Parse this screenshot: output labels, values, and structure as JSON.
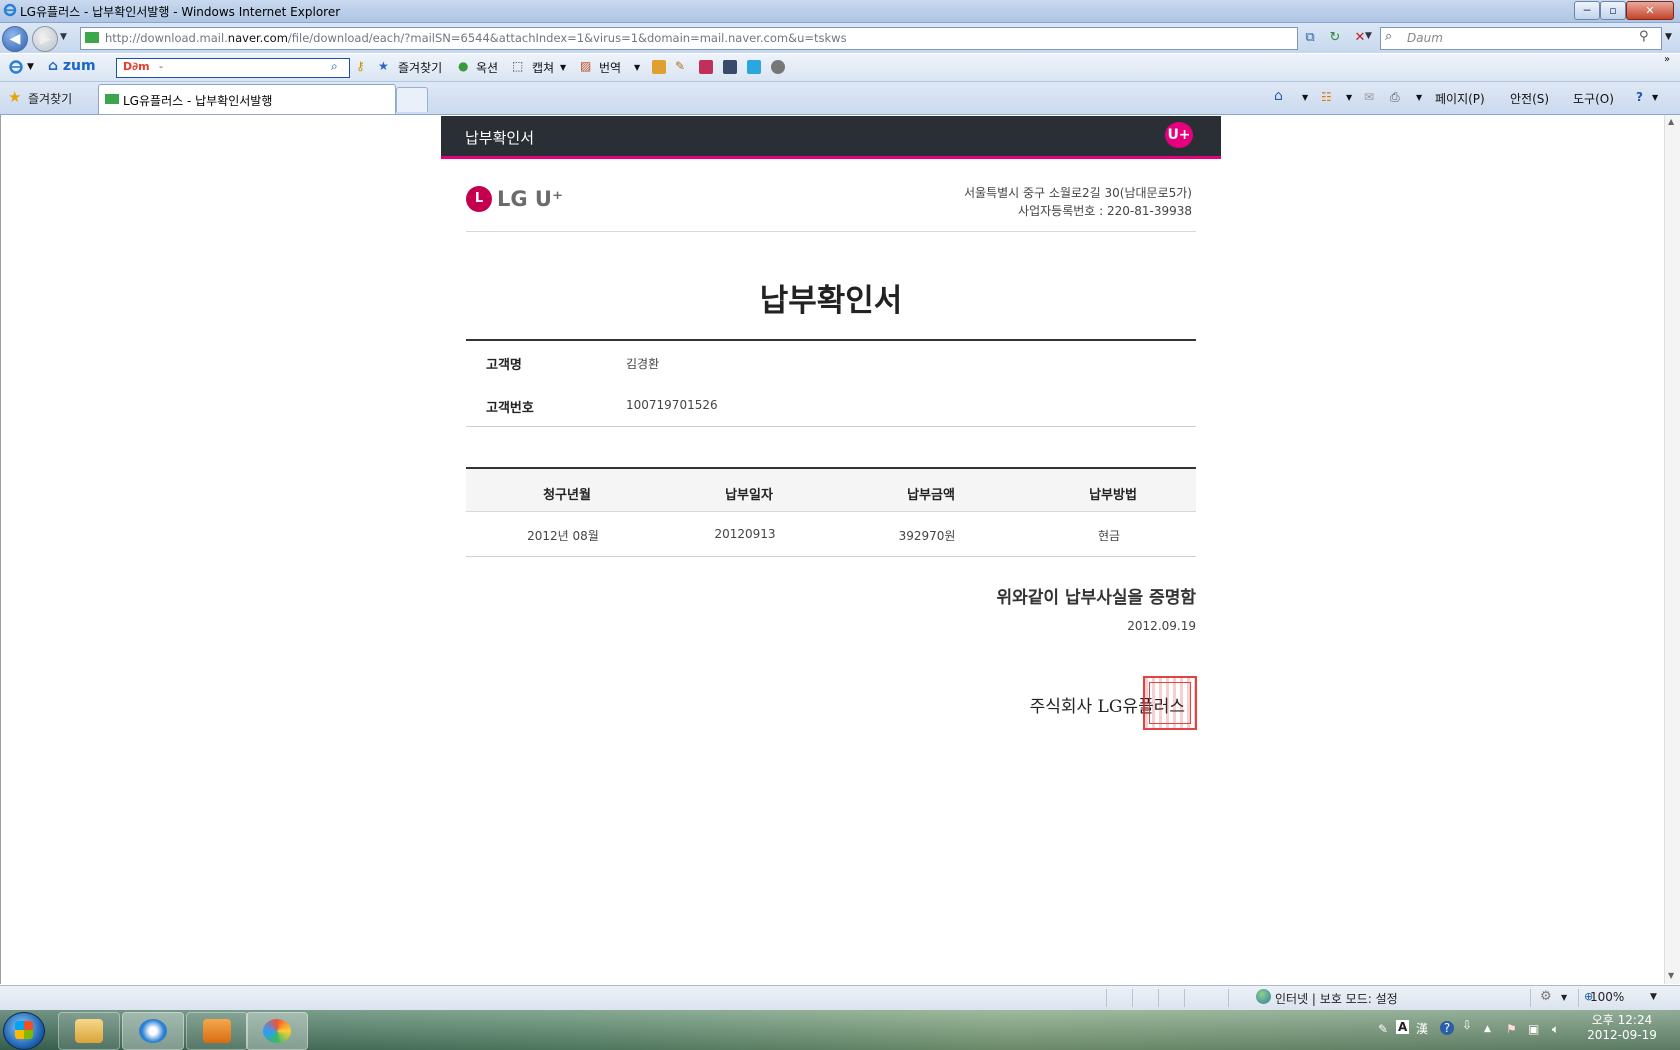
{
  "window": {
    "title": "LG유플러스 - 납부확인서발행 - Windows Internet Explorer",
    "minimize": "─",
    "maximize": "▫",
    "close": "✕"
  },
  "address_bar": {
    "url_prefix": "http://download.mail.",
    "url_domain": "naver.com",
    "url_rest": "/file/download/each/?mailSN=6544&attachIndex=1&virus=1&domain=mail.naver.com&u=tskws",
    "search_engine": "Daum"
  },
  "toolbar": {
    "zum": "zum",
    "daum": "D∂m",
    "daum_value": "-",
    "favorites": "즐겨찾기",
    "options": "옥션",
    "capture": "캡쳐",
    "translate": "번역"
  },
  "tabs": {
    "favorites": "즐겨찾기",
    "active": "LG유플러스 - 납부확인서발행"
  },
  "commands": {
    "page": "페이지(P)",
    "safety": "안전(S)",
    "tools": "도구(O)"
  },
  "document": {
    "header_title": "납부확인서",
    "badge": "U+",
    "brand": "LG U⁺",
    "brand_mark": "L",
    "address": "서울특별시 중구 소월로2길 30(남대문로5가)",
    "business_no": "사업자등록번호 : 220-81-39938",
    "title": "납부확인서",
    "customer": {
      "name_label": "고객명",
      "name": "김경환",
      "number_label": "고객번호",
      "number": "100719701526"
    },
    "bill_table": {
      "headers": [
        "청구년월",
        "납부일자",
        "납부금액",
        "납부방법"
      ],
      "rows": [
        [
          "2012년 08월",
          "20120913",
          "392970원",
          "현금"
        ]
      ]
    },
    "certification": "위와같이 납부사실을 증명함",
    "date": "2012.09.19",
    "company": "주식회사 LG유플러스"
  },
  "statusbar": {
    "zone": "인터넷 | 보호 모드: 설정",
    "zoom": "100%"
  },
  "taskbar": {
    "time": "오후 12:24",
    "date": "2012-09-19"
  }
}
